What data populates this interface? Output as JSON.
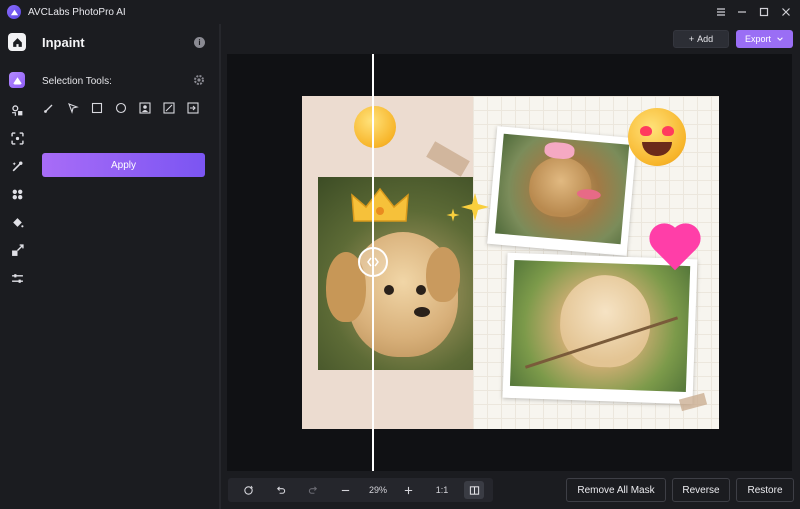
{
  "app": {
    "title": "AVCLabs PhotoPro AI"
  },
  "rail": {
    "items": [
      "home",
      "inpaint",
      "face-enhance",
      "crop-expand",
      "magic-fill",
      "background",
      "paint-bucket",
      "resize",
      "adjust"
    ]
  },
  "panel": {
    "title": "Inpaint",
    "selection_label": "Selection Tools:",
    "apply_label": "Apply",
    "tools": [
      "brush-icon",
      "lasso-icon",
      "rectangle-icon",
      "ellipse-icon",
      "portrait-select-icon",
      "smart-select-icon",
      "import-mask-icon"
    ]
  },
  "header": {
    "add_label": "Add",
    "export_label": "Export"
  },
  "zoom": {
    "value": "29%",
    "fit_label": "1:1"
  },
  "actions": {
    "remove_all_mask": "Remove All Mask",
    "reverse": "Reverse",
    "restore": "Restore"
  },
  "colors": {
    "accent": "#9a6ef5",
    "apply_gradient_start": "#a86cf7",
    "apply_gradient_end": "#7b55f2",
    "background": "#1b1c20",
    "canvas": "#101114"
  }
}
